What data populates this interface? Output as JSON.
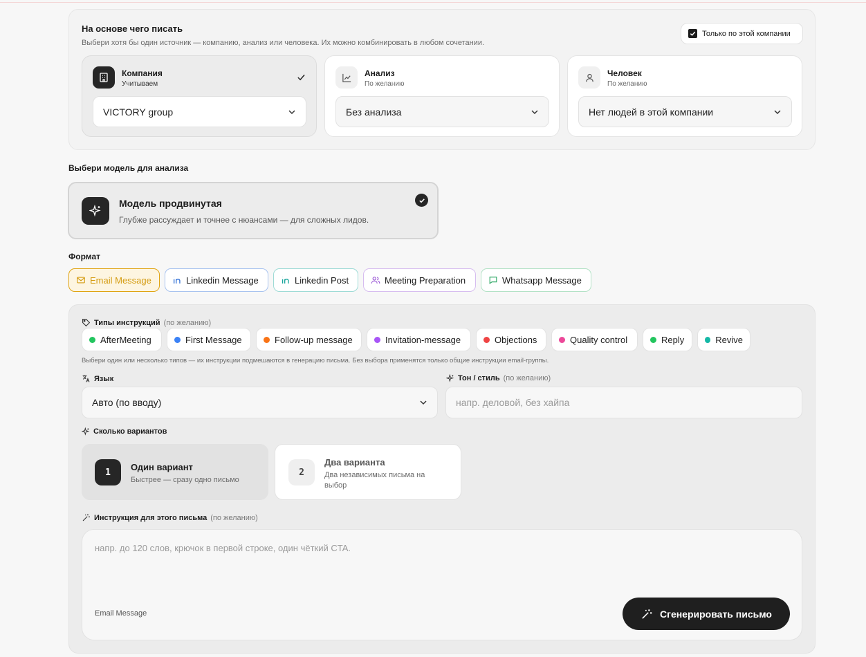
{
  "source": {
    "title": "На основе чего писать",
    "subtitle": "Выбери хотя бы один источник — компанию, анализ или человека. Их можно комбинировать в любом сочетании.",
    "only_company_label": "Только по этой компании",
    "only_company_checked": true,
    "cards": [
      {
        "title": "Компания",
        "status": "Учитываем",
        "value": "VICTORY group",
        "icon": "building-icon",
        "selected": true
      },
      {
        "title": "Анализ",
        "status": "По желанию",
        "value": "Без анализа",
        "icon": "chart-line-icon",
        "selected": false
      },
      {
        "title": "Человек",
        "status": "По желанию",
        "value": "Нет людей в этой компании",
        "icon": "user-icon",
        "selected": false
      }
    ]
  },
  "model": {
    "section_title": "Выбери модель для анализа",
    "name": "Модель продвинутая",
    "description": "Глубже рассуждает и точнее с нюансами — для сложных лидов.",
    "selected": true
  },
  "format": {
    "title": "Формат",
    "items": [
      {
        "label": "Email Message",
        "icon": "mail-icon",
        "color": "#e0a412",
        "active": true
      },
      {
        "label": "Linkedin Message",
        "icon": "linkedin-icon",
        "color": "#2f6fd6",
        "active": false
      },
      {
        "label": "Linkedin Post",
        "icon": "linkedin-icon",
        "color": "#14a39a",
        "active": false
      },
      {
        "label": "Meeting Preparation",
        "icon": "users-icon",
        "color": "#9b59d6",
        "active": false
      },
      {
        "label": "Whatsapp Message",
        "icon": "chat-icon",
        "color": "#2fa866",
        "active": false
      }
    ]
  },
  "instructions": {
    "title": "Типы инструкций",
    "optional": "(по желанию)",
    "types": [
      {
        "label": "AfterMeeting",
        "color": "#22c55e"
      },
      {
        "label": "First Message",
        "color": "#3b82f6"
      },
      {
        "label": "Follow-up message",
        "color": "#f97316"
      },
      {
        "label": "Invitation-message",
        "color": "#a855f7"
      },
      {
        "label": "Objections",
        "color": "#ef4444"
      },
      {
        "label": "Quality control",
        "color": "#ec4899"
      },
      {
        "label": "Reply",
        "color": "#22c55e"
      },
      {
        "label": "Revive",
        "color": "#14b8a6"
      }
    ],
    "hint": "Выбери один или несколько типов — их инструкции подмешаются в генерацию письма. Без выбора применятся только общие инструкции email-группы."
  },
  "language": {
    "label": "Язык",
    "value": "Авто (по вводу)"
  },
  "tone": {
    "label": "Тон / стиль",
    "optional": "(по желанию)",
    "placeholder": "напр. деловой, без хайпа"
  },
  "variants": {
    "label": "Сколько вариантов",
    "options": [
      {
        "num": "1",
        "title": "Один вариант",
        "desc": "Быстрее — сразу одно письмо",
        "selected": true
      },
      {
        "num": "2",
        "title": "Два варианта",
        "desc": "Два независимых письма на выбор",
        "selected": false
      }
    ]
  },
  "instruction": {
    "label": "Инструкция для этого письма",
    "optional": "(по желанию)",
    "placeholder": "напр. до 120 слов, крючок в первой строке, один чёткий CTA.",
    "format_tag": "Email Message",
    "generate_label": "Сгенерировать письмо"
  }
}
